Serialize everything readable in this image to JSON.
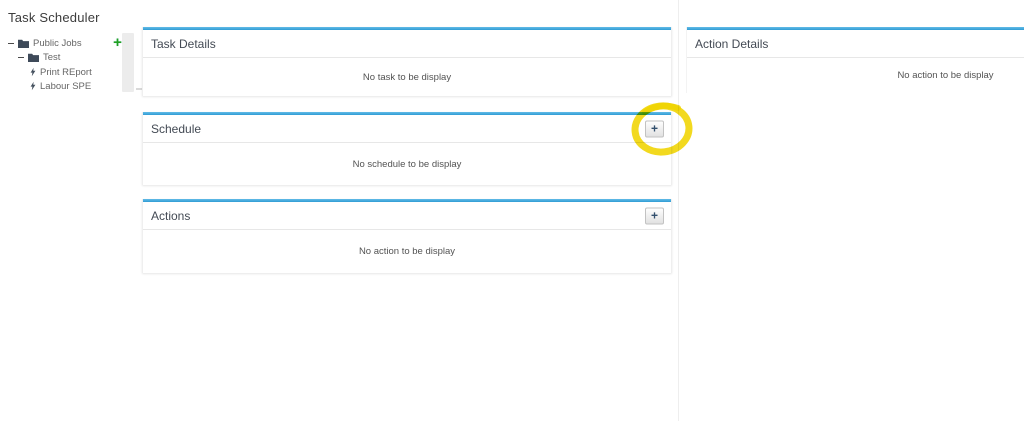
{
  "app": {
    "title": "Task Scheduler"
  },
  "tree": {
    "add_button_label": "+",
    "items": [
      {
        "label": "Public Jobs",
        "type": "folder",
        "expanded": true
      },
      {
        "label": "Test",
        "type": "folder",
        "expanded": true
      },
      {
        "label": "Print REport",
        "type": "task"
      },
      {
        "label": "Labour SPE",
        "type": "task"
      }
    ]
  },
  "panels": {
    "task_details": {
      "title": "Task Details",
      "empty_text": "No task to be display"
    },
    "schedule": {
      "title": "Schedule",
      "empty_text": "No schedule to be display",
      "add_button_label": "+"
    },
    "actions": {
      "title": "Actions",
      "empty_text": "No action to be display",
      "add_button_label": "+"
    },
    "action_details": {
      "title": "Action Details",
      "empty_text": "No action to be display"
    }
  },
  "colors": {
    "accent_blue": "#2f9cd4",
    "highlight_yellow": "#f0d400",
    "tree_add_green": "#21a121"
  }
}
